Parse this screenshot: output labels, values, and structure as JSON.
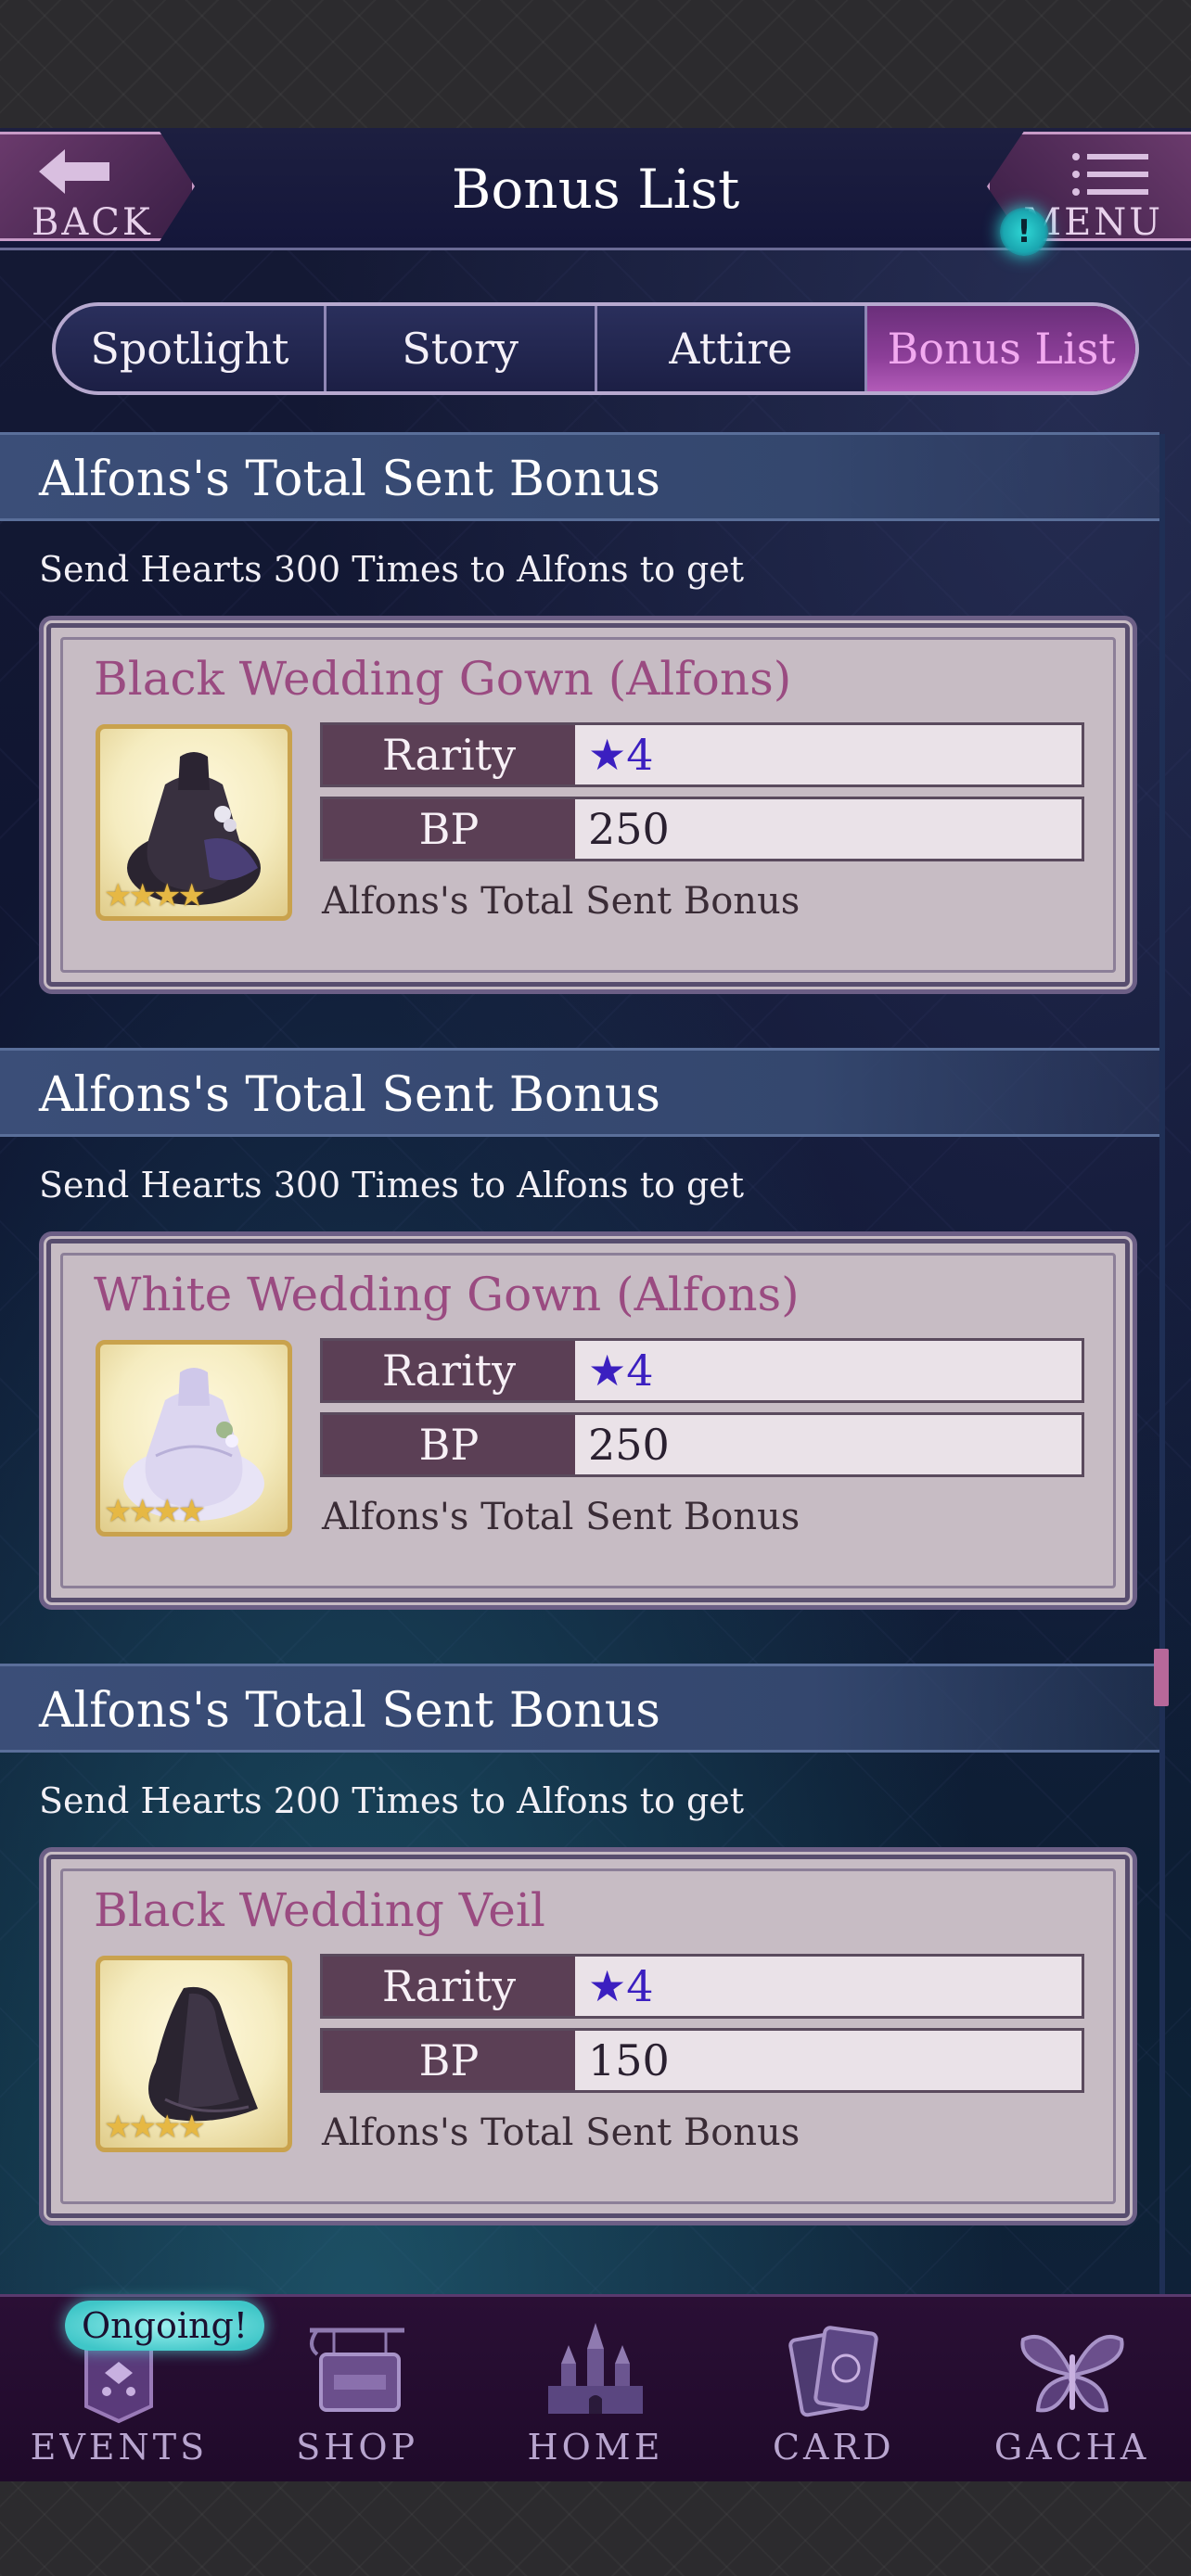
{
  "header": {
    "back_label": "BACK",
    "title": "Bonus List",
    "menu_label": "MENU",
    "menu_alert": "!"
  },
  "tabs": [
    {
      "label": "Spotlight",
      "active": false
    },
    {
      "label": "Story",
      "active": false
    },
    {
      "label": "Attire",
      "active": false
    },
    {
      "label": "Bonus List",
      "active": true
    }
  ],
  "bonuses": [
    {
      "section_title": "Alfons's Total Sent Bonus",
      "description": "Send Hearts 300 Times to Alfons to get",
      "item_name": "Black Wedding Gown (Alfons)",
      "rarity_label": "Rarity",
      "rarity_value": "★4",
      "bp_label": "BP",
      "bp_value": "250",
      "note": "Alfons's Total Sent Bonus",
      "thumb_stars": "★★★★",
      "thumb_icon": "black-gown-icon"
    },
    {
      "section_title": "Alfons's Total Sent Bonus",
      "description": "Send Hearts 300 Times to Alfons to get",
      "item_name": "White Wedding Gown (Alfons)",
      "rarity_label": "Rarity",
      "rarity_value": "★4",
      "bp_label": "BP",
      "bp_value": "250",
      "note": "Alfons's Total Sent Bonus",
      "thumb_stars": "★★★★",
      "thumb_icon": "white-gown-icon"
    },
    {
      "section_title": "Alfons's Total Sent Bonus",
      "description": "Send Hearts 200 Times to Alfons to get",
      "item_name": "Black Wedding Veil",
      "rarity_label": "Rarity",
      "rarity_value": "★4",
      "bp_label": "BP",
      "bp_value": "150",
      "note": "Alfons's Total Sent Bonus",
      "thumb_stars": "★★★★",
      "thumb_icon": "black-veil-icon"
    }
  ],
  "bottom_nav": {
    "badge": "Ongoing!",
    "items": [
      {
        "label": "EVENTS",
        "icon": "events-icon"
      },
      {
        "label": "SHOP",
        "icon": "shop-icon"
      },
      {
        "label": "HOME",
        "icon": "castle-icon"
      },
      {
        "label": "CARD",
        "icon": "cards-icon"
      },
      {
        "label": "GACHA",
        "icon": "butterfly-icon"
      }
    ]
  },
  "colors": {
    "accent": "#9a4b81",
    "tab_active_text": "#f2a9f0",
    "rarity_text": "#3b1fc0",
    "alert": "#2fd7d5"
  }
}
